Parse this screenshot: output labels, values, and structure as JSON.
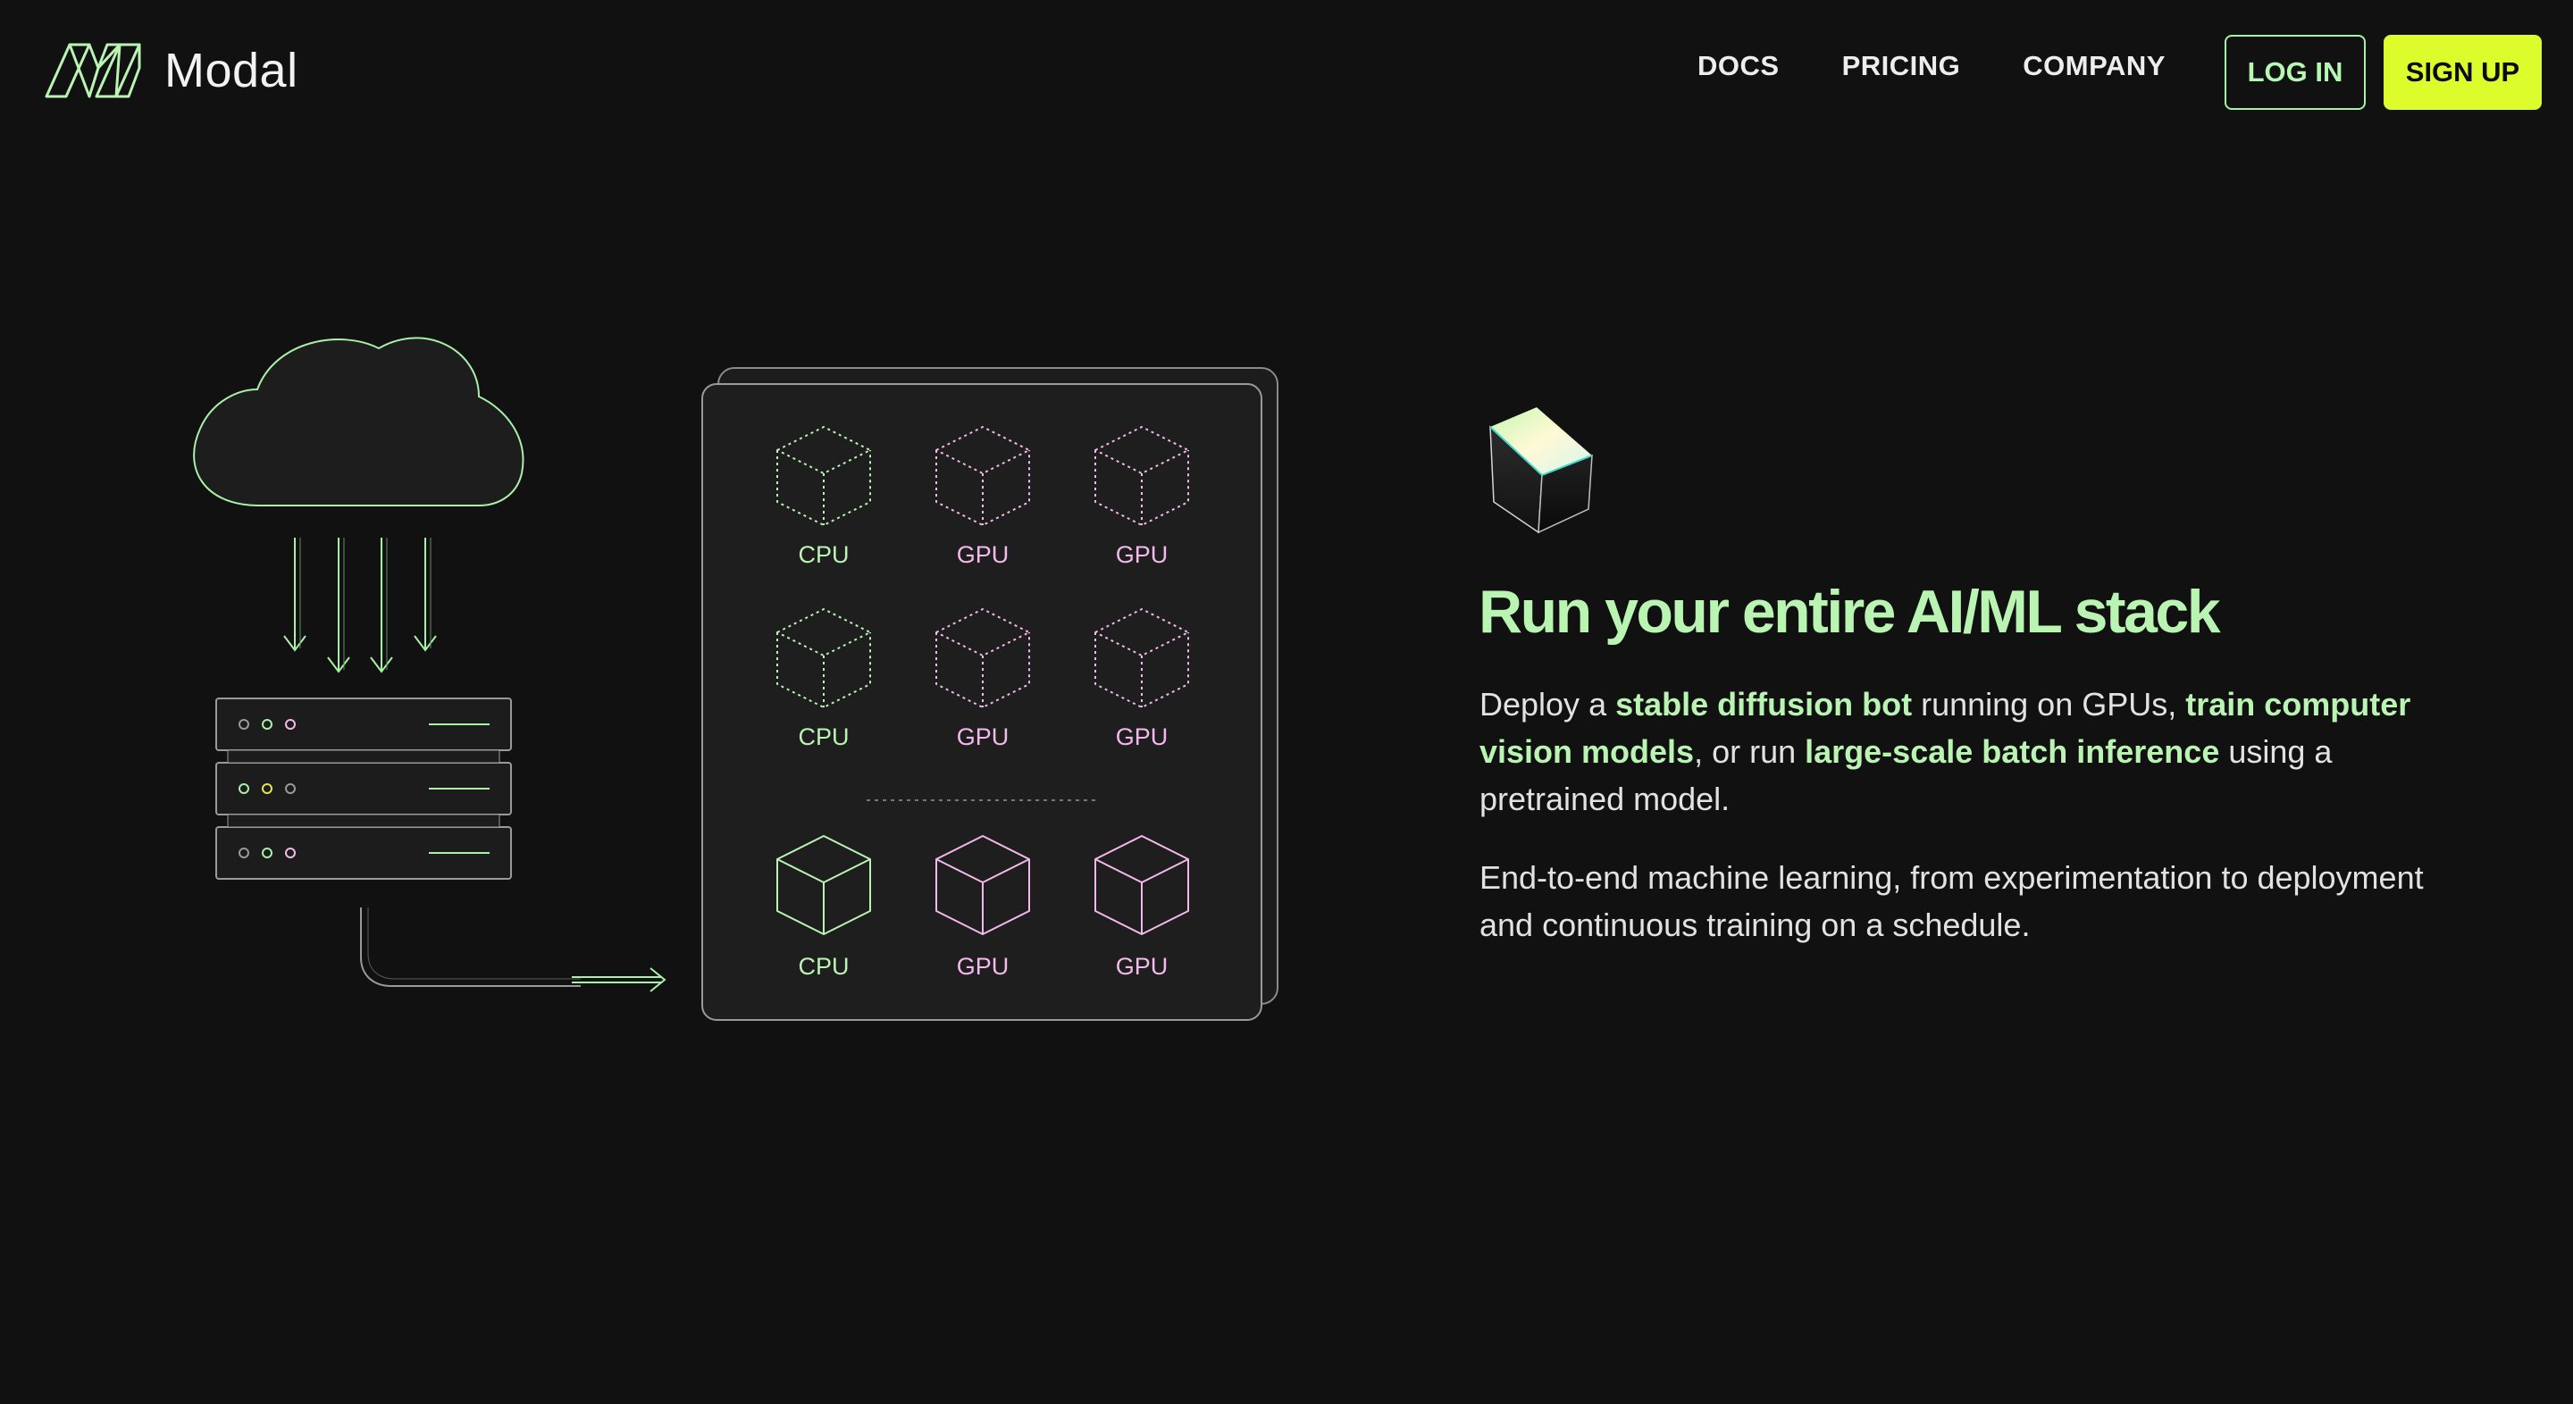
{
  "brand": {
    "name": "Modal",
    "logo_icon": "modal-logo-icon"
  },
  "nav": {
    "links": [
      "DOCS",
      "PRICING",
      "COMPANY"
    ],
    "login_label": "LOG IN",
    "signup_label": "SIGN UP"
  },
  "diagram": {
    "labels": {
      "row1": [
        "CPU",
        "GPU",
        "GPU"
      ],
      "row2": [
        "CPU",
        "GPU",
        "GPU"
      ],
      "row3": [
        "CPU",
        "GPU",
        "GPU"
      ]
    }
  },
  "hero": {
    "icon": "glowing-cube-icon",
    "headline": "Run your entire AI/ML stack",
    "p1": {
      "t1": "Deploy a ",
      "h1": "stable diffusion bot",
      "t2": " running on GPUs, ",
      "h2": "train computer vision models",
      "t3": ", or run ",
      "h3": "large-scale batch inference",
      "t4": " using a pretrained model."
    },
    "p2": "End-to-end machine learning, from experimentation to deployment and continuous training on a schedule."
  },
  "colors": {
    "background": "#111111",
    "accent_green": "#b9f4b3",
    "accent_yellow": "#ddfc2c",
    "gpu_pink": "#f5b8ec"
  }
}
